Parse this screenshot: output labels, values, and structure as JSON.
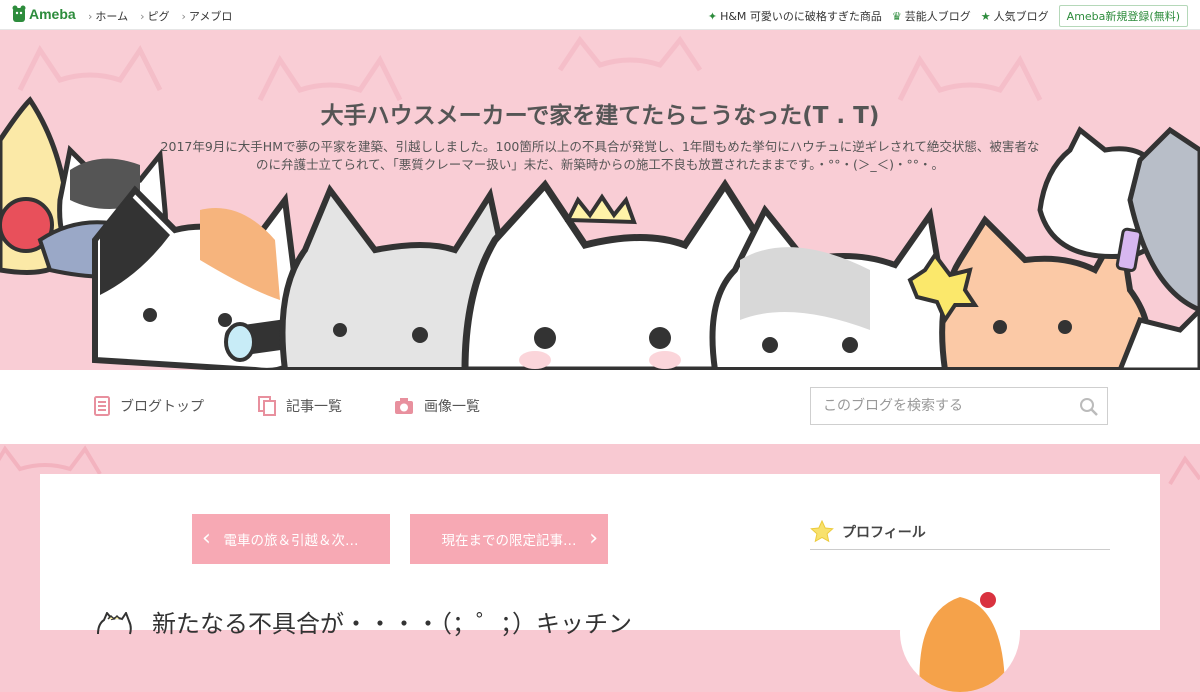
{
  "topbar": {
    "logo": "Ameba",
    "nav_left": [
      "ホーム",
      "ピグ",
      "アメブロ"
    ],
    "nav_right": [
      {
        "icon": "sparkle-icon",
        "label": "H&M 可愛いのに破格すぎた商品"
      },
      {
        "icon": "crown-icon",
        "label": "芸能人ブログ"
      },
      {
        "icon": "star-icon",
        "label": "人気ブログ"
      }
    ],
    "register": "Ameba新規登録(無料)"
  },
  "header": {
    "title": "大手ハウスメーカーで家を建てたらこうなった(T . T)",
    "description": "2017年9月に大手HMで夢の平家を建築、引越ししました。100箇所以上の不具合が発覚し、1年間もめた挙句にハウチュに逆ギレされて絶交状態、被害者なのに弁護士立てられて、「悪質クレーマー扱い」未だ、新築時からの施工不良も放置されたままです。・°°・(＞_＜)・°°・。"
  },
  "menu": {
    "items": [
      {
        "icon": "blog-top-icon",
        "label": "ブログトップ"
      },
      {
        "icon": "article-list-icon",
        "label": "記事一覧"
      },
      {
        "icon": "camera-icon",
        "label": "画像一覧"
      }
    ],
    "search_placeholder": "このブログを検索する"
  },
  "content": {
    "prev_label": "電車の旅＆引越＆次…",
    "next_label": "現在までの限定記事…",
    "post_title": "新たなる不具合が・・・・（；゜；）キッチン",
    "sidebar_title": "プロフィール"
  },
  "colors": {
    "brand_green": "#2d8c3c",
    "header_pink": "#f9cdd5",
    "pager_pink": "#f7a9b4",
    "icon_pink": "#e8909e"
  }
}
